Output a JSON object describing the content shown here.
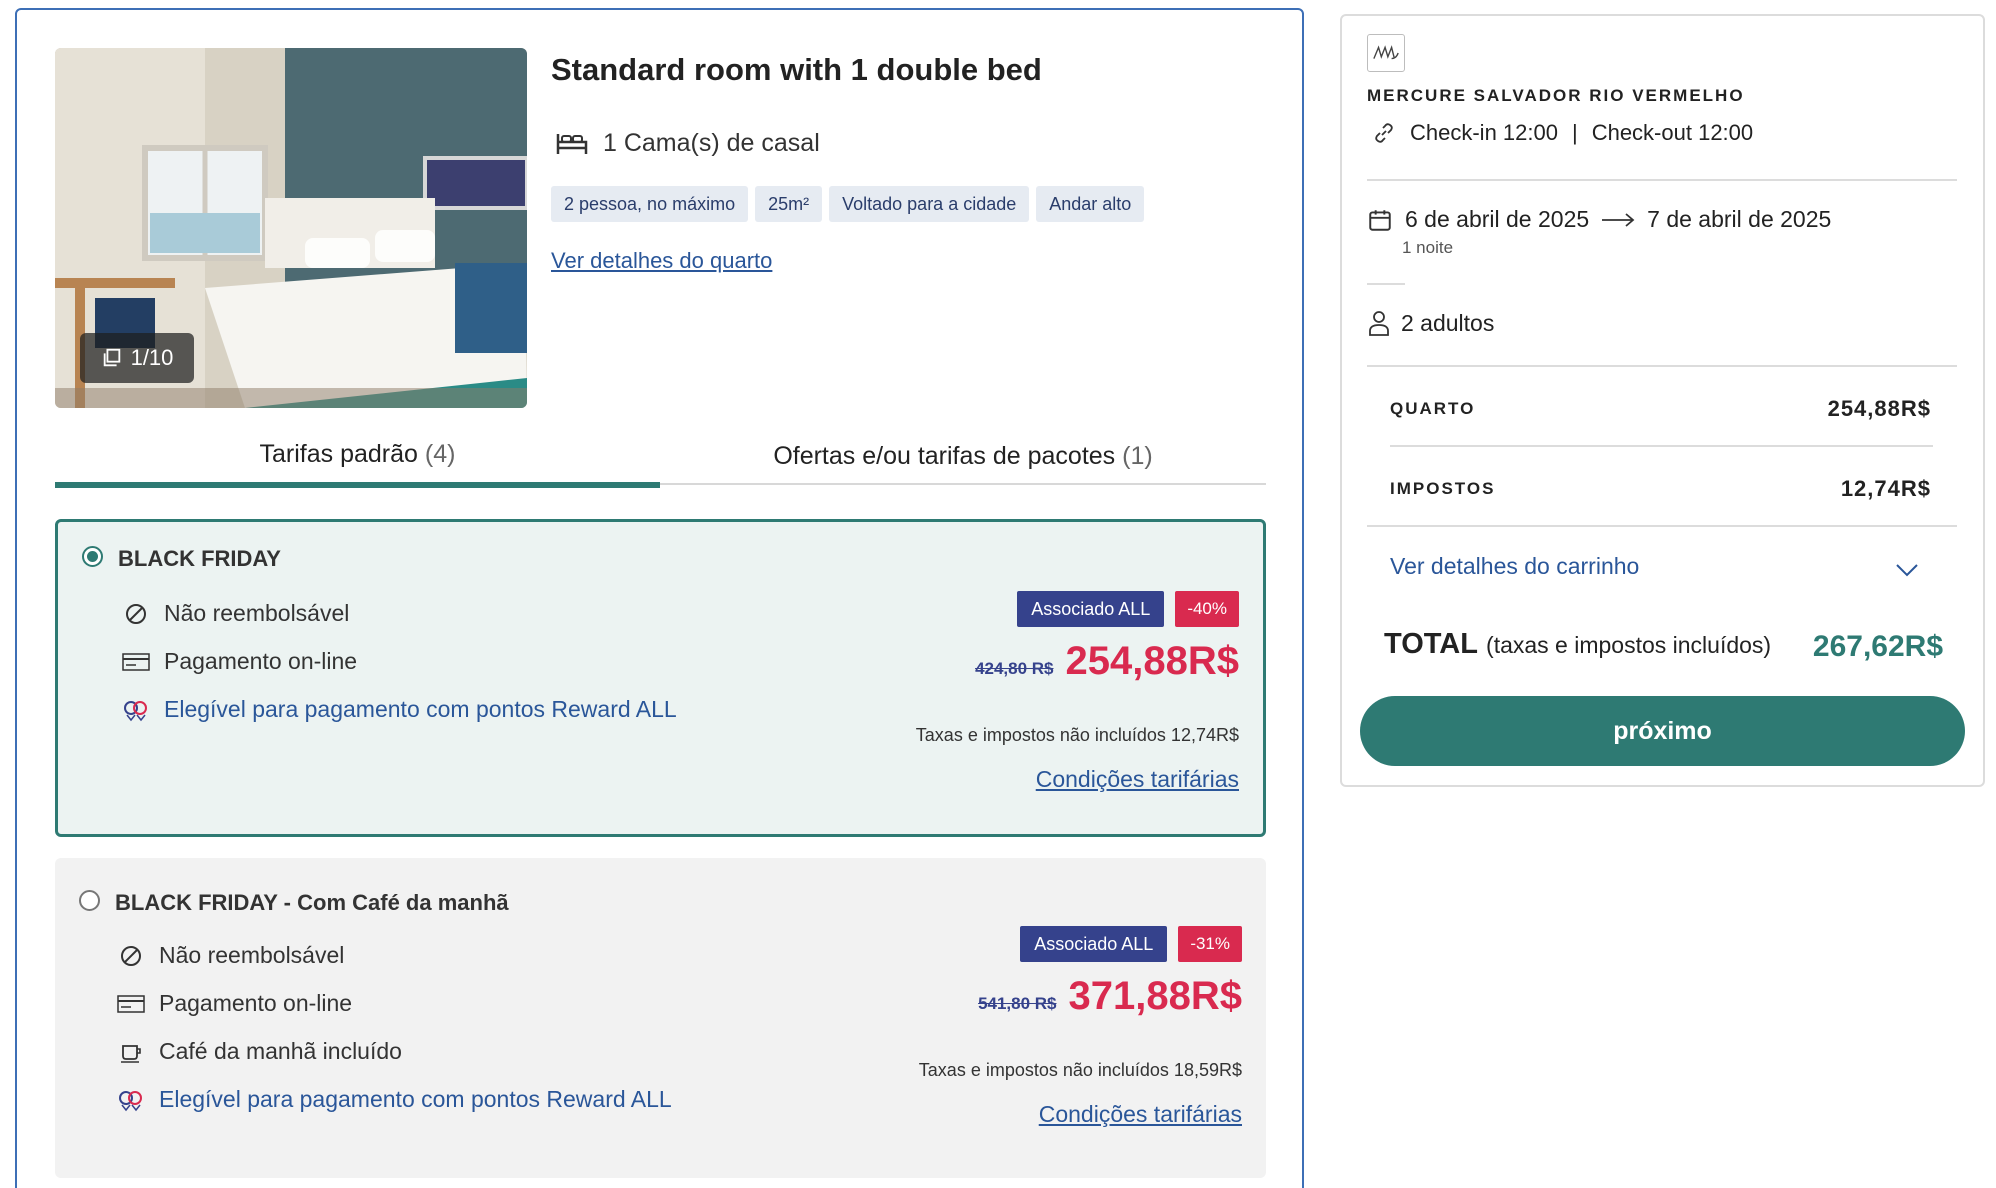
{
  "room": {
    "title": "Standard room with 1 double bed",
    "bed": "1 Cama(s) de casal",
    "photo_counter": "1/10",
    "tags": [
      "2 pessoa, no máximo",
      "25m²",
      "Voltado para a cidade",
      "Andar alto"
    ],
    "details_link": "Ver detalhes do quarto"
  },
  "tabs": [
    {
      "label": "Tarifas padrão",
      "count": "(4)"
    },
    {
      "label": "Ofertas e/ou tarifas de pacotes",
      "count": "(1)"
    }
  ],
  "rates": [
    {
      "name": "BLACK FRIDAY",
      "selected": true,
      "features": [
        "Não reembolsável",
        "Pagamento on-line"
      ],
      "reward": "Elegível para pagamento com pontos Reward ALL",
      "badge": "Associado ALL",
      "discount": "-40%",
      "old_price": "424,80 R$",
      "price": "254,88R$",
      "taxes": "Taxas e impostos não incluídos 12,74R$",
      "conditions": "Condições tarifárias"
    },
    {
      "name": "BLACK FRIDAY - Com Café da manhã",
      "selected": false,
      "features": [
        "Não reembolsável",
        "Pagamento on-line",
        "Café da manhã incluído"
      ],
      "reward": "Elegível para pagamento com pontos Reward ALL",
      "badge": "Associado ALL",
      "discount": "-31%",
      "old_price": "541,80 R$",
      "price": "371,88R$",
      "taxes": "Taxas e impostos não incluídos 18,59R$",
      "conditions": "Condições tarifárias"
    }
  ],
  "summary": {
    "hotel": "MERCURE SALVADOR RIO VERMELHO",
    "checkin": "Check-in 12:00",
    "separator": "|",
    "checkout": "Check-out 12:00",
    "date_from": "6 de abril de 2025",
    "date_to": "7 de abril de 2025",
    "nights": "1 noite",
    "guests": "2 adultos",
    "room_label": "QUARTO",
    "room_value": "254,88R$",
    "tax_label": "IMPOSTOS",
    "tax_value": "12,74R$",
    "cart_link": "Ver detalhes do carrinho",
    "total_label": "TOTAL",
    "total_note": "(taxas e impostos incluídos)",
    "total_value": "267,62R$",
    "next_button": "próximo"
  },
  "colors": {
    "accent": "#2e7a73",
    "price_red": "#d92a4f",
    "link_blue": "#2a5699",
    "badge_navy": "#35428c",
    "card_border": "#3d6fb6"
  }
}
